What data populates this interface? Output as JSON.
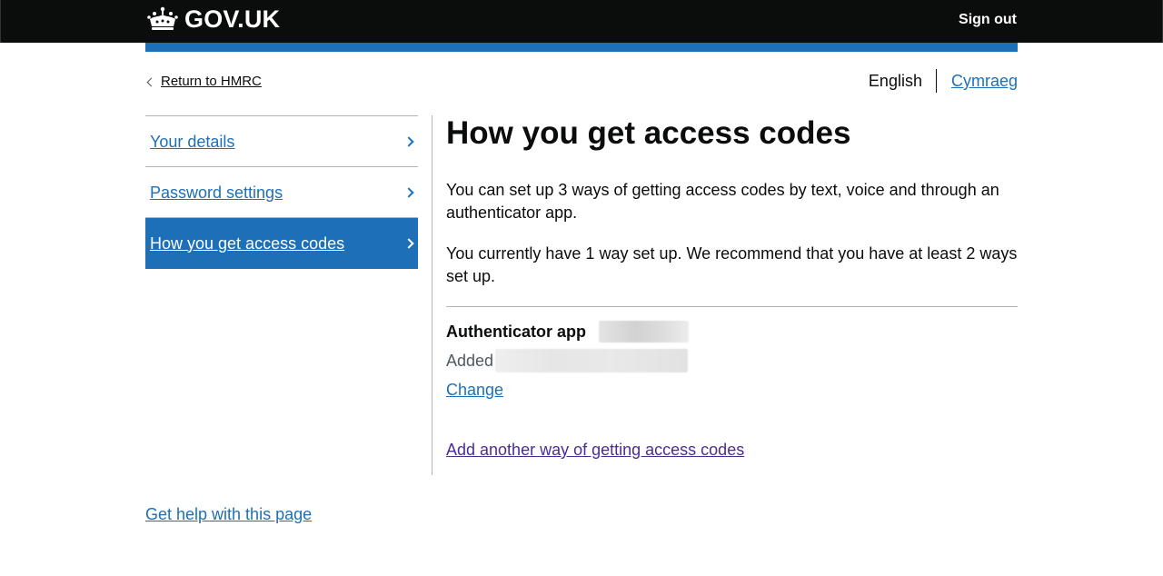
{
  "header": {
    "logo_text": "GOV.UK",
    "logo_icon": "crown-icon",
    "sign_out": "Sign out"
  },
  "back_link": {
    "label": "Return to HMRC",
    "icon": "chevron-left-icon"
  },
  "language": {
    "current": "English",
    "alternate": "Cymraeg"
  },
  "subnav": {
    "items": [
      {
        "label": "Your details",
        "active": false
      },
      {
        "label": "Password settings",
        "active": false
      },
      {
        "label": "How you get access codes",
        "active": true
      }
    ],
    "arrow_icon": "chevron-right-icon"
  },
  "main": {
    "title": "How you get access codes",
    "intro": "You can set up 3 ways of getting access codes by text, voice and through an authenticator app.",
    "status": "You currently have 1 way set up. We recommend that you have at least 2 ways set up.",
    "method": {
      "title": "Authenticator app",
      "added_label": "Added",
      "change_label": "Change"
    },
    "add_another": "Add another way of getting access codes"
  },
  "footer": {
    "help_link": "Get help with this page"
  },
  "colors": {
    "header_bg": "#0b0c0c",
    "brand_blue": "#1d70b8",
    "link": "#1d70b8",
    "visited_link": "#4c2c92",
    "border": "#b1b4b6",
    "secondary_text": "#505a5f"
  }
}
